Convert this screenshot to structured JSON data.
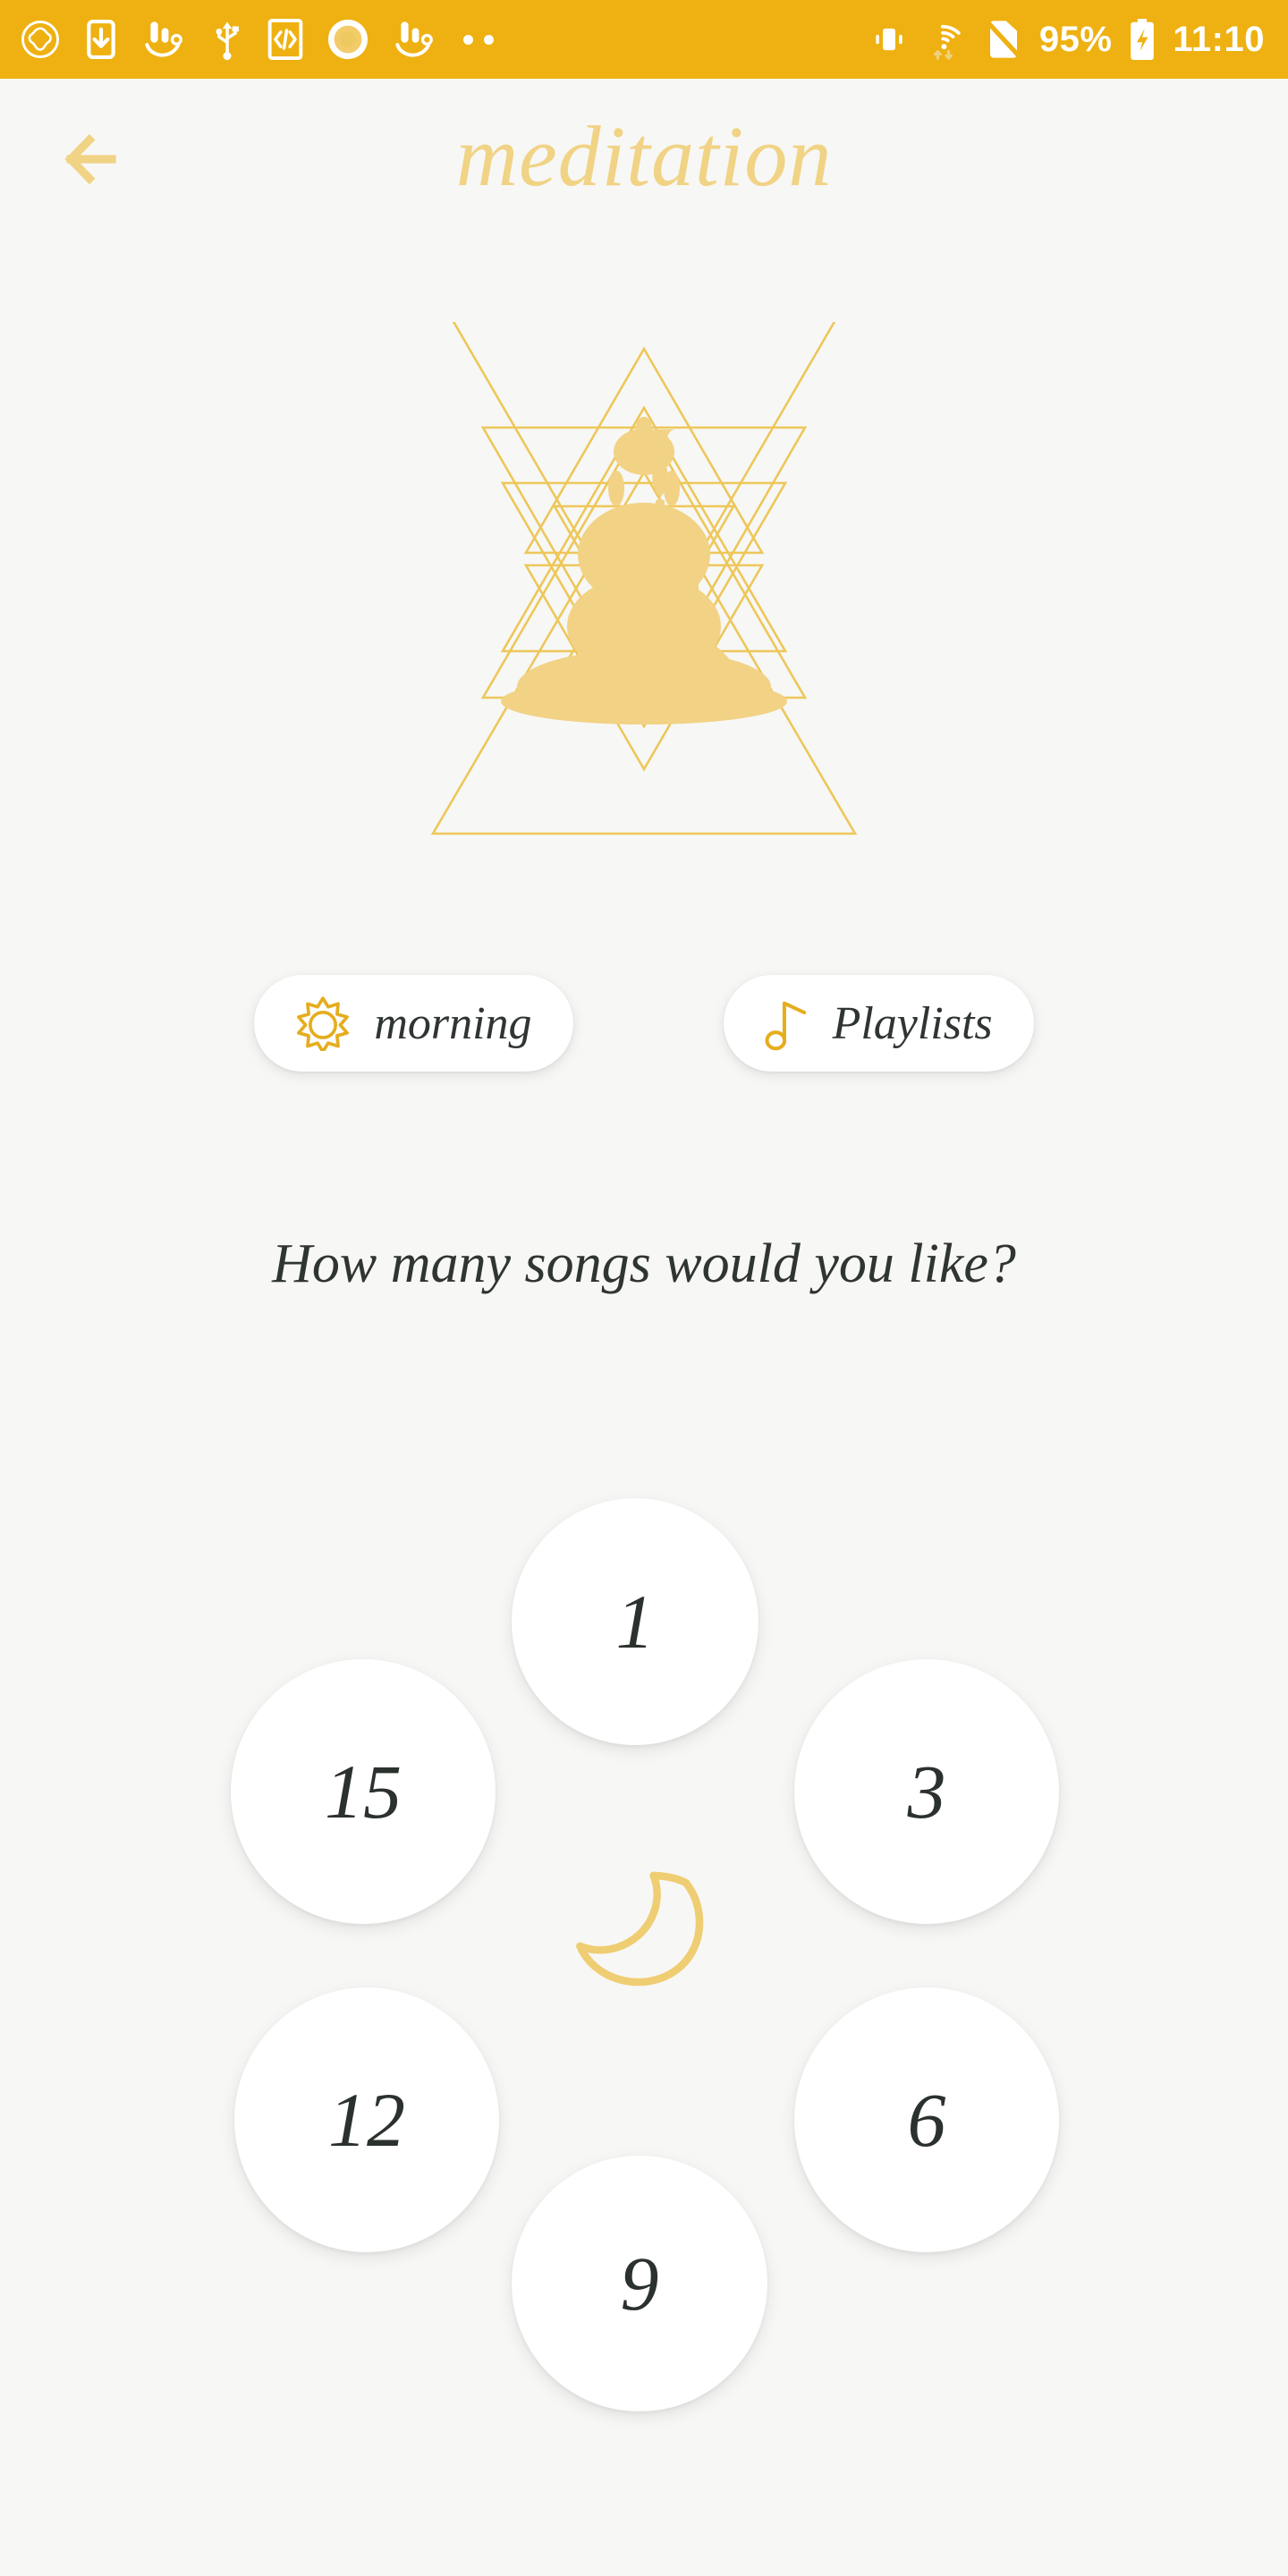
{
  "status_bar": {
    "background_color": "#eeb111",
    "left_icons": [
      {
        "name": "sync-circle-icon",
        "label": "sync"
      },
      {
        "name": "phone-download-icon",
        "label": "download-to-device"
      },
      {
        "name": "touchpal-keyboard-icon",
        "label": "keyboard"
      },
      {
        "name": "usb-icon",
        "label": "usb"
      },
      {
        "name": "developer-code-icon",
        "label": "developer-options"
      },
      {
        "name": "record-circle-icon",
        "label": "screen-record"
      },
      {
        "name": "touchpal-keyboard-icon-2",
        "label": "keyboard-alt"
      }
    ],
    "more_indicator": "..",
    "right_icons": [
      {
        "name": "vibrate-icon",
        "label": "vibrate"
      },
      {
        "name": "wifi-icon",
        "label": "wifi"
      },
      {
        "name": "no-sim-icon",
        "label": "no-sim"
      }
    ],
    "battery_percent": "95%",
    "battery_state": "charging",
    "time": "11:10"
  },
  "header": {
    "back_icon": "arrow-left-icon",
    "title": "meditation",
    "title_color": "#f1d385"
  },
  "hero": {
    "name": "buddha-sri-yantra-illustration",
    "outline_color": "#eec75a",
    "fill_color": "#f2d284"
  },
  "mode_buttons": [
    {
      "id": "morning",
      "label": "morning",
      "icon": "sun-icon",
      "icon_color": "#e5ad1f",
      "selected": true
    },
    {
      "id": "playlists",
      "label": "Playlists",
      "icon": "music-note-icon",
      "icon_color": "#e5ad1f",
      "selected": false
    }
  ],
  "question": "How many songs would you like?",
  "song_count_options": [
    {
      "value": "1",
      "position": "top"
    },
    {
      "value": "3",
      "position": "right-upper"
    },
    {
      "value": "6",
      "position": "right-lower"
    },
    {
      "value": "9",
      "position": "bottom"
    },
    {
      "value": "12",
      "position": "left-lower"
    },
    {
      "value": "15",
      "position": "left-upper"
    }
  ],
  "center_icon": {
    "name": "crescent-moon-icon",
    "color": "#efcd72"
  },
  "theme": {
    "background": "#f7f7f5",
    "accent": "#eeb111",
    "gold_light": "#f1d385",
    "text_dark": "#2b312d"
  }
}
